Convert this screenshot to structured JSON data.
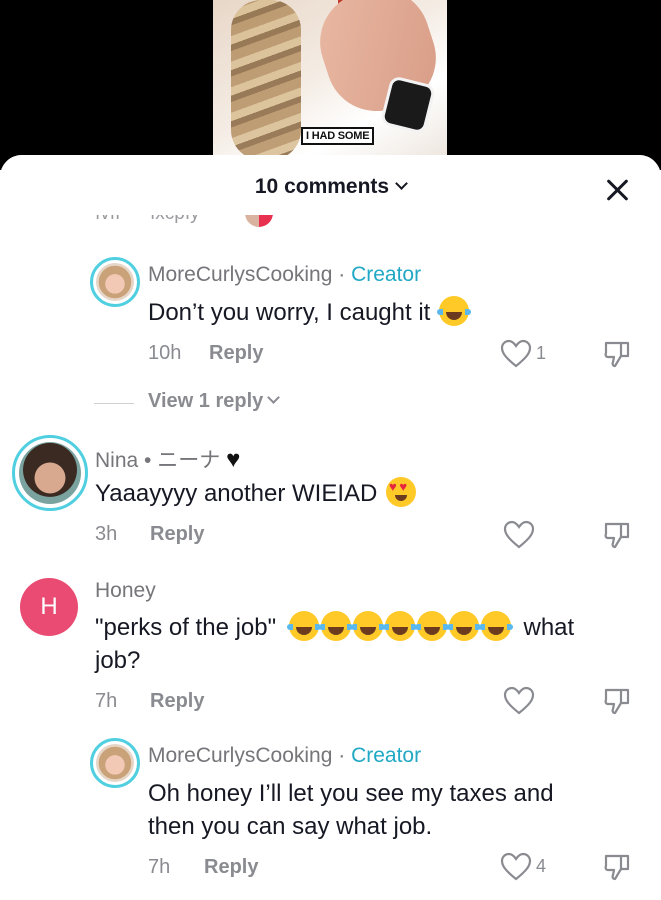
{
  "video": {
    "caption": "I HAD SOME"
  },
  "sheet": {
    "title": "10 comments"
  },
  "comments": [
    {
      "username": "MoreCurlysCooking",
      "tag": "Creator",
      "text": "Don’t you worry, I caught it",
      "emoji": "face-with-tears-of-joy",
      "time": "10h",
      "reply": "Reply",
      "likes": "1",
      "view_replies": "View 1 reply"
    },
    {
      "username": "Nina • ニーナ",
      "badge_emoji": "black-heart",
      "text": "Yaaayyyy another WIEIAD",
      "emoji": "smiling-face-with-heart-eyes",
      "time": "3h",
      "reply": "Reply"
    },
    {
      "username": "Honey",
      "avatar_letter": "H",
      "text_prefix": "\"perks of the job\"",
      "text_suffix": "what",
      "text_line2": "job?",
      "emoji_count": 7,
      "time": "7h",
      "reply": "Reply"
    },
    {
      "username": "MoreCurlysCooking",
      "tag": "Creator",
      "text_line1": "Oh honey I’ll let you see my taxes and",
      "text_line2": "then you can say what job.",
      "time": "7h",
      "reply": "Reply",
      "likes": "4"
    }
  ],
  "colors": {
    "creator_tag": "#20a8c4",
    "avatar_ring": "#4fcfe0",
    "honey_avatar": "#e94b73"
  }
}
